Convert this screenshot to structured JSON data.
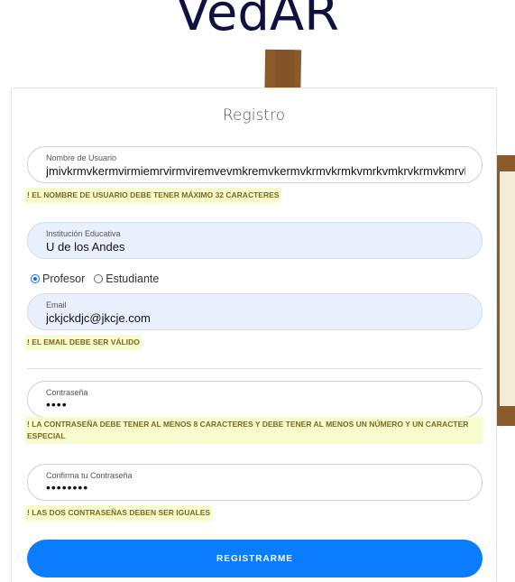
{
  "brand": "VedAR",
  "form": {
    "title": "Registro",
    "username": {
      "label": "Nombre de Usuario",
      "value": "jmivkrmvkermvirmiemrvirmviremvevmkremvkermvkrmvkrmkvmrkvmkrvkrmvkmrvk"
    },
    "username_error": "! El nombre de usuario debe tener máximo 32 caracteres",
    "institution": {
      "label": "Institución Educativa",
      "value": "U de los Andes"
    },
    "role_options": [
      {
        "label": "Profesor",
        "selected": true
      },
      {
        "label": "Estudiante",
        "selected": false
      }
    ],
    "email": {
      "label": "Email",
      "value": "jckjckdjc@jkcje.com"
    },
    "email_error": "! El email debe ser válido",
    "password": {
      "label": "Contraseña",
      "value": "••••"
    },
    "password_error": "! La contraseña debe tener al menos 8 caracteres y debe tener al menos un número y un caracter especial",
    "confirm": {
      "label": "Confirma tu Contraseña",
      "value": "••••••••"
    },
    "confirm_error": "! Las dos contraseñas deben ser iguales",
    "submit_label": "REGISTRARME"
  },
  "colors": {
    "accent": "#0a7cff",
    "error_bg": "#f7fccf",
    "brand": "#0e1240"
  }
}
